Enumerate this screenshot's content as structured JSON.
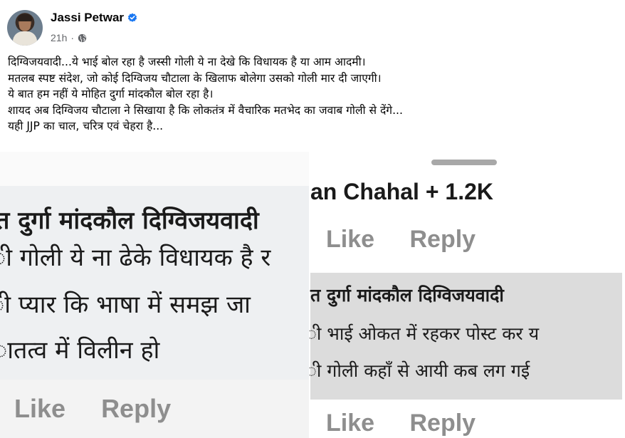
{
  "post": {
    "author": "Jassi Petwar",
    "time": "21h",
    "separator": "·",
    "verified_icon": "verified-badge-icon",
    "privacy_icon": "globe-icon",
    "accent_color": "#1877f2",
    "lines": [
      "दिग्विजयवादी...ये भाई बोल रहा है जस्सी गोली ये ना देखे कि विधायक है या आम आदमी।",
      "मतलब स्पष्ट संदेश, जो कोई दिग्विजय चौटाला के खिलाफ बोलेगा उसको गोली मार दी जाएगी।",
      "ये बात हम नहीं ये मोहित दुर्गा मांदकौल बोल रहा है।",
      "शायद अब दिग्विजय चौटाला ने सिखाया है कि लोकतंत्र में वैचारिक मतभेद का जवाब गोली से देंगे...",
      "यही JJP का चाल, चरित्र एवं चेहरा है..."
    ]
  },
  "left_screenshot": {
    "name_line": "त दुर्गा मांदकौल दिग्विजयवादी",
    "comment_lines": [
      "ी गोली ये ना ढेके विधायक है र",
      "ी प्यार कि भाषा में समझ जा",
      "ातत्व में विलीन हो"
    ],
    "like_label": "Like",
    "reply_label": "Reply"
  },
  "right_screenshot": {
    "commenter_line": "an Chahal + 1.2K",
    "like_label": "Like",
    "reply_label": "Reply",
    "name_line": "त दुर्गा मांदकौल दिग्विजयवादी",
    "comment_lines": [
      "ी भाई ओकत में रहकर पोस्ट कर य",
      "ी गोली कहाँ से आयी कब लग गई"
    ],
    "like_label_2": "Like",
    "reply_label_2": "Reply"
  }
}
